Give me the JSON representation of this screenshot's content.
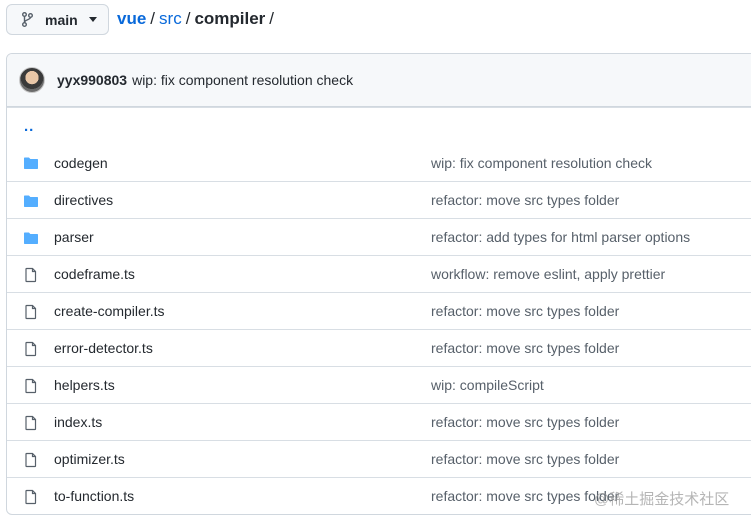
{
  "branch": {
    "label": "main",
    "icon": "git-branch-icon"
  },
  "breadcrumb": {
    "root": "vue",
    "sep1": "/",
    "mid": "src",
    "sep2": "/",
    "current": "compiler",
    "sep3": "/"
  },
  "commit": {
    "author": "yyx990803",
    "message": "wip: fix component resolution check"
  },
  "parent_link": "..",
  "files": [
    {
      "type": "folder",
      "name": "codegen",
      "message": "wip: fix component resolution check"
    },
    {
      "type": "folder",
      "name": "directives",
      "message": "refactor: move src types folder"
    },
    {
      "type": "folder",
      "name": "parser",
      "message": "refactor: add types for html parser options"
    },
    {
      "type": "file",
      "name": "codeframe.ts",
      "message": "workflow: remove eslint, apply prettier"
    },
    {
      "type": "file",
      "name": "create-compiler.ts",
      "message": "refactor: move src types folder"
    },
    {
      "type": "file",
      "name": "error-detector.ts",
      "message": "refactor: move src types folder"
    },
    {
      "type": "file",
      "name": "helpers.ts",
      "message": "wip: compileScript"
    },
    {
      "type": "file",
      "name": "index.ts",
      "message": "refactor: move src types folder"
    },
    {
      "type": "file",
      "name": "optimizer.ts",
      "message": "refactor: move src types folder"
    },
    {
      "type": "file",
      "name": "to-function.ts",
      "message": "refactor: move src types folder"
    }
  ],
  "watermark": "@稀土掘金技术社区",
  "colors": {
    "accent": "#0969da",
    "folder": "#54aeff",
    "muted": "#57606a",
    "border": "#d0d7de"
  }
}
